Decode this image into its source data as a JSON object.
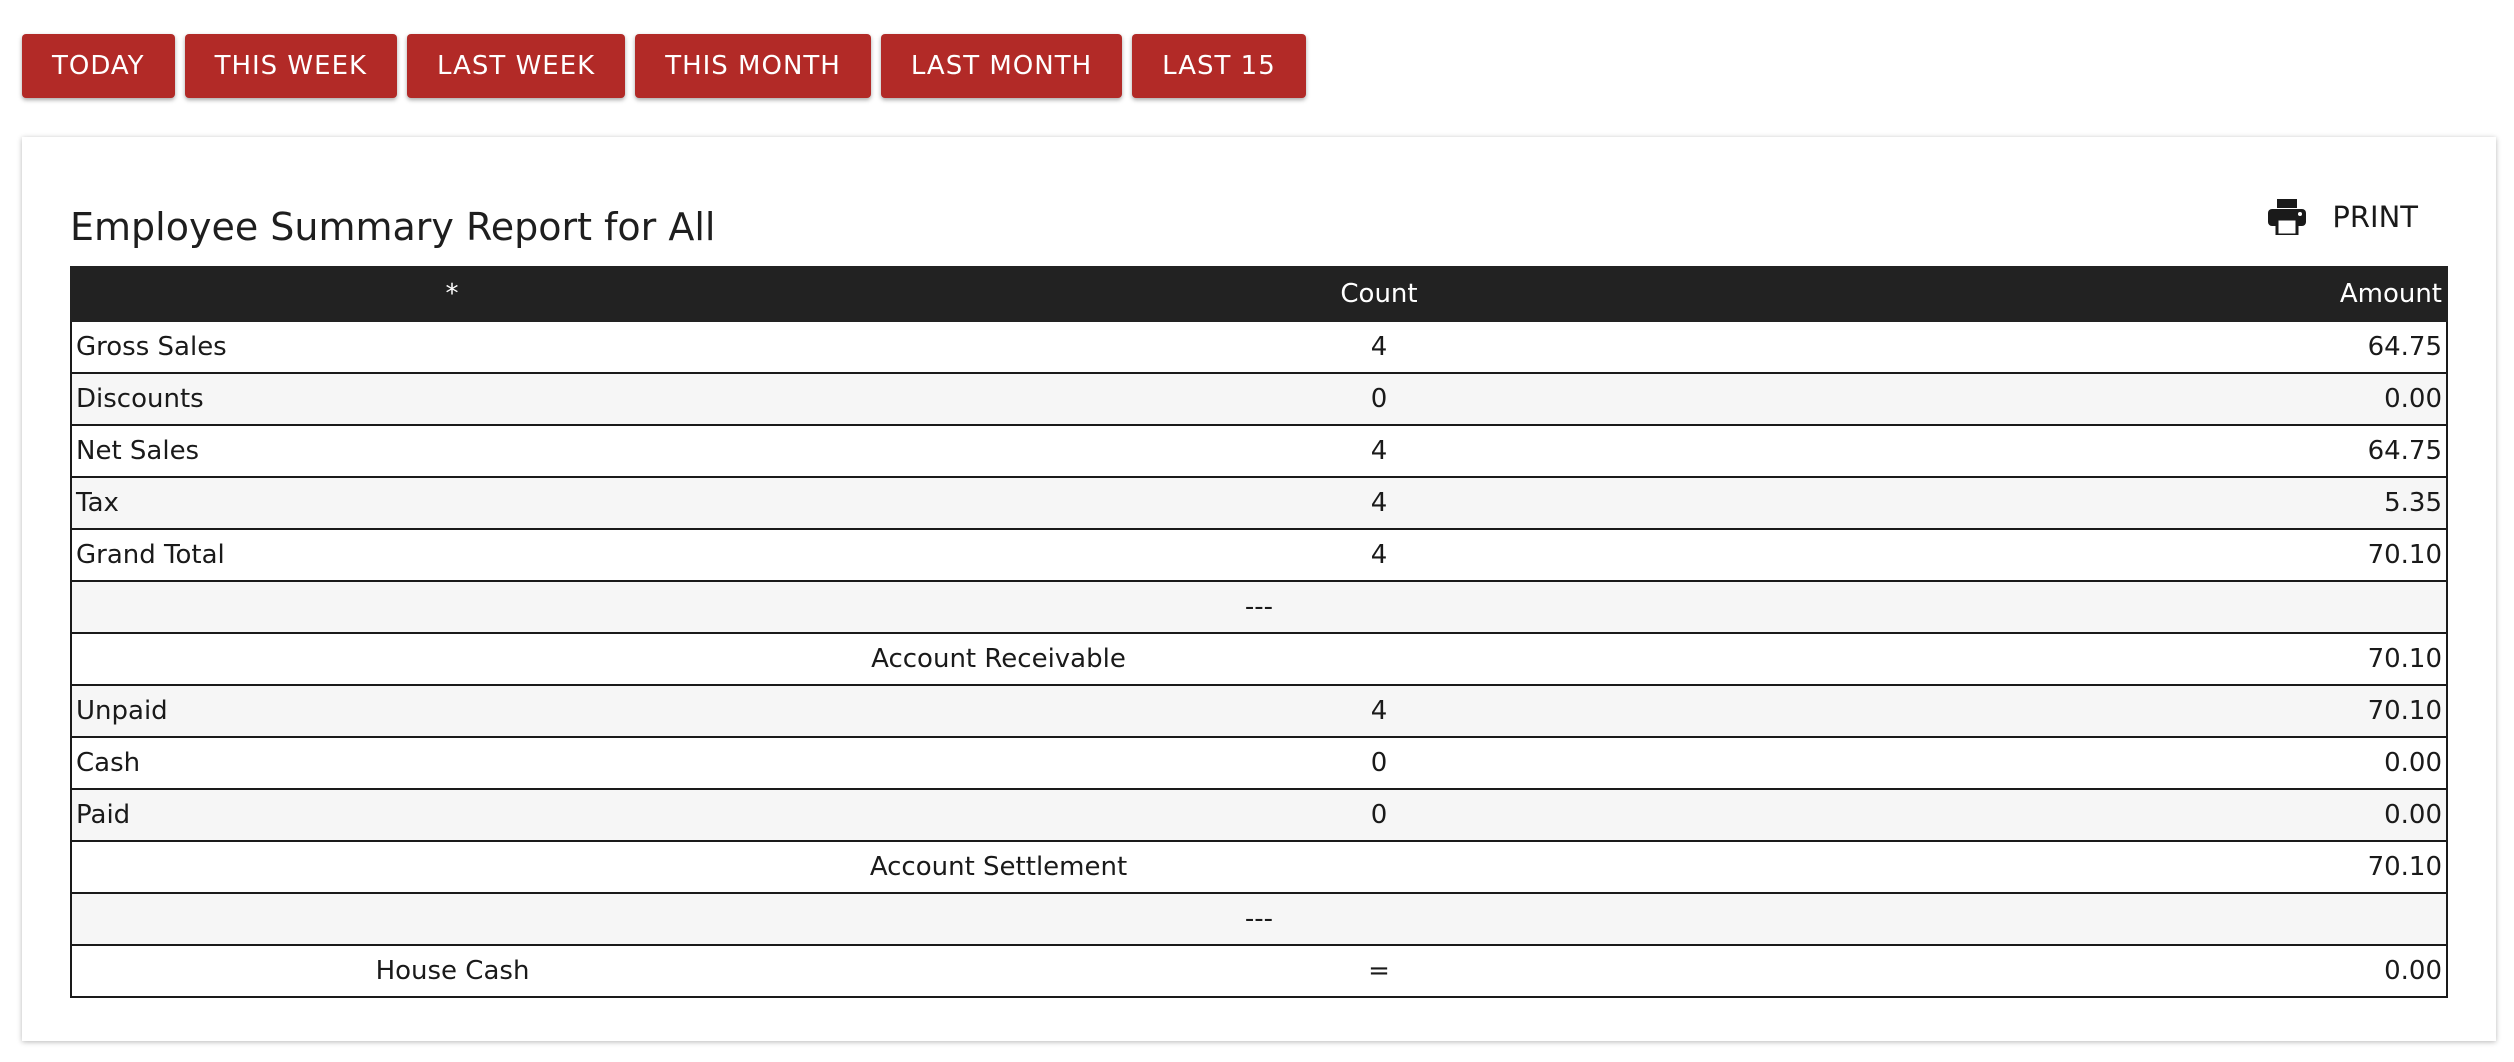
{
  "range_buttons": [
    "TODAY",
    "THIS WEEK",
    "LAST WEEK",
    "THIS MONTH",
    "LAST MONTH",
    "LAST 15"
  ],
  "report": {
    "title": "Employee Summary Report for All",
    "print_label": "PRINT",
    "columns": {
      "label": "*",
      "count": "Count",
      "amount": "Amount"
    },
    "rows": [
      {
        "label": "Gross Sales",
        "count": "4",
        "amount": "64.75"
      },
      {
        "label": "Discounts",
        "count": "0",
        "amount": "0.00"
      },
      {
        "label": "Net Sales",
        "count": "4",
        "amount": "64.75"
      },
      {
        "label": "Tax",
        "count": "4",
        "amount": "5.35"
      },
      {
        "label": "Grand Total",
        "count": "4",
        "amount": "70.10"
      },
      {
        "separator": "---"
      },
      {
        "label": "Account Receivable",
        "amount": "70.10"
      },
      {
        "label": "Unpaid",
        "count": "4",
        "amount": "70.10"
      },
      {
        "label": "Cash",
        "count": "0",
        "amount": "0.00"
      },
      {
        "label": "Paid",
        "count": "0",
        "amount": "0.00"
      },
      {
        "label": "Account Settlement",
        "amount": "70.10"
      },
      {
        "separator": "---"
      },
      {
        "label": "House Cash",
        "count": "=",
        "amount": "0.00"
      }
    ]
  },
  "colors": {
    "button": "#b22a27",
    "header": "#222222",
    "stripe": "#f6f6f6"
  },
  "icons": {
    "print": "printer-icon"
  }
}
